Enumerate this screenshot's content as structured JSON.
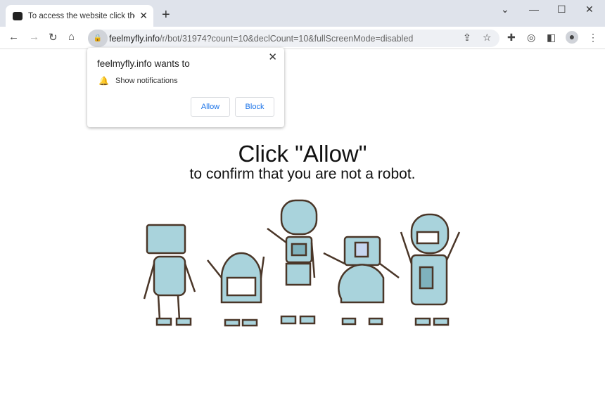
{
  "tab": {
    "title": "To access the website click the \"Allow\"",
    "close": "✕",
    "new_tab": "+"
  },
  "window": {
    "minimize": "⌄",
    "min": "—",
    "max": "☐",
    "close": "✕"
  },
  "nav": {
    "back": "←",
    "forward": "→",
    "reload": "↻",
    "home": "⌂"
  },
  "omnibox": {
    "domain": "feelmyfly.info",
    "path": "/r/bot/31974?count=10&declCount=10&fullScreenMode=disabled"
  },
  "toolbar_icons": [
    "share-icon",
    "star-icon",
    "extensions-icon",
    "media-icon",
    "sidepanel-icon",
    "profile-icon",
    "menu-icon"
  ],
  "popup": {
    "title": "feelmyfly.info wants to",
    "permission": "Show notifications",
    "allow": "Allow",
    "block": "Block",
    "close": "✕"
  },
  "page": {
    "headline": "Click \"Allow\"",
    "subline": "to confirm that you are not a robot."
  },
  "colors": {
    "robot_body": "#a9d3dc",
    "robot_outline": "#4a3628",
    "link": "#1a73e8"
  }
}
